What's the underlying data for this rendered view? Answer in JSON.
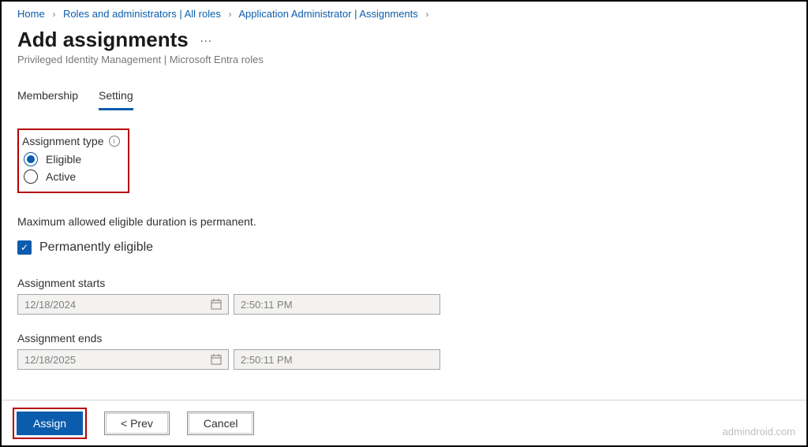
{
  "breadcrumb": {
    "home": "Home",
    "roles": "Roles and administrators | All roles",
    "app_admin": "Application Administrator | Assignments"
  },
  "header": {
    "title": "Add assignments",
    "subtitle": "Privileged Identity Management | Microsoft Entra roles"
  },
  "tabs": {
    "membership": "Membership",
    "setting": "Setting"
  },
  "assignment_type": {
    "label": "Assignment type",
    "eligible": "Eligible",
    "active": "Active"
  },
  "duration_text": "Maximum allowed eligible duration is permanent.",
  "permanent_checkbox": "Permanently eligible",
  "starts": {
    "label": "Assignment starts",
    "date": "12/18/2024",
    "time": "2:50:11 PM"
  },
  "ends": {
    "label": "Assignment ends",
    "date": "12/18/2025",
    "time": "2:50:11 PM"
  },
  "buttons": {
    "assign": "Assign",
    "prev": "<  Prev",
    "cancel": "Cancel"
  },
  "watermark": "admindroid.com"
}
